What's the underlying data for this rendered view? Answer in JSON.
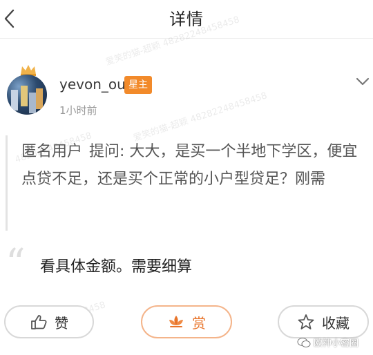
{
  "header": {
    "title": "详情"
  },
  "post": {
    "username": "yevon_ou",
    "badge": "星主",
    "time": "1小时前",
    "question_tag": "匿名用户",
    "question_text": "提问: 大大，是买一个半地下学区，便宜点贷不足，还是买个正常的小户型贷足？刚需",
    "answer": "看具体金额。需要细算"
  },
  "actions": {
    "like_label": "赞",
    "reward_label": "赏",
    "favorite_label": "收藏"
  },
  "watermarks": [
    "爱笑的猫-超颖 48282248458458",
    "爱笑的猫-超颖 48282248458458",
    "48282248458458",
    "48282248458458"
  ],
  "footer": {
    "source": "欧神小密圈"
  },
  "colors": {
    "badge_bg": "#f28a2a",
    "accent": "#e8742a",
    "muted": "#999999"
  }
}
